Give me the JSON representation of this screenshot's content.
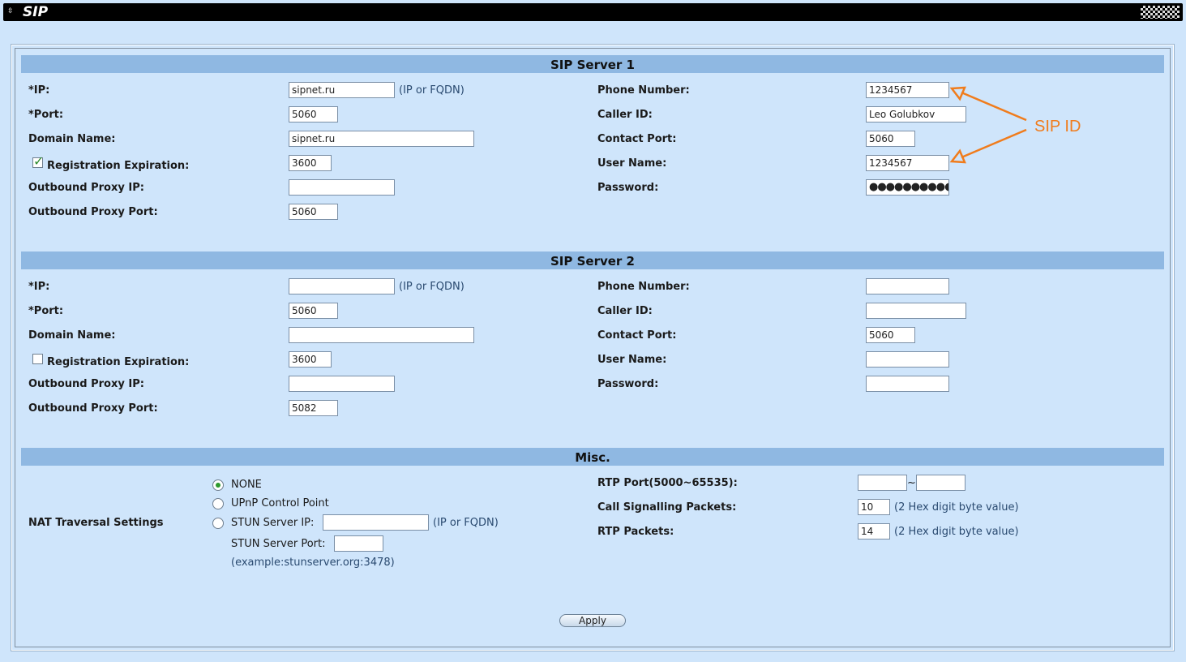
{
  "titlebar": {
    "title": "SIP",
    "icon": "menu-arrow-icon"
  },
  "server1": {
    "heading": "SIP Server 1",
    "ip_label": "*IP:",
    "ip_value": "sipnet.ru",
    "ip_hint": "(IP or FQDN)",
    "port_label": "*Port:",
    "port_value": "5060",
    "domain_label": "Domain Name:",
    "domain_value": "sipnet.ru",
    "reg_label": "Registration Expiration:",
    "reg_checked": true,
    "reg_value": "3600",
    "oproxy_ip_label": "Outbound Proxy IP:",
    "oproxy_ip_value": "",
    "oproxy_port_label": "Outbound Proxy Port:",
    "oproxy_port_value": "5060",
    "phone_label": "Phone Number:",
    "phone_value": "1234567",
    "callerid_label": "Caller ID:",
    "callerid_value": "Leo Golubkov",
    "contact_port_label": "Contact Port:",
    "contact_port_value": "5060",
    "username_label": "User Name:",
    "username_value": "1234567",
    "password_label": "Password:",
    "password_value": "●●●●●●●●●●●●●"
  },
  "server2": {
    "heading": "SIP Server 2",
    "ip_label": "*IP:",
    "ip_value": "",
    "ip_hint": "(IP or FQDN)",
    "port_label": "*Port:",
    "port_value": "5060",
    "domain_label": "Domain Name:",
    "domain_value": "",
    "reg_label": "Registration Expiration:",
    "reg_checked": false,
    "reg_value": "3600",
    "oproxy_ip_label": "Outbound Proxy IP:",
    "oproxy_ip_value": "",
    "oproxy_port_label": "Outbound Proxy Port:",
    "oproxy_port_value": "5082",
    "phone_label": "Phone Number:",
    "phone_value": "",
    "callerid_label": "Caller ID:",
    "callerid_value": "",
    "contact_port_label": "Contact Port:",
    "contact_port_value": "5060",
    "username_label": "User Name:",
    "username_value": "",
    "password_label": "Password:",
    "password_value": ""
  },
  "misc": {
    "heading": "Misc.",
    "nat_label": "NAT Traversal Settings",
    "opt_none": "NONE",
    "opt_upnp": "UPnP Control Point",
    "opt_stun_ip": "STUN Server IP:",
    "stun_ip_value": "",
    "stun_ip_hint": "(IP or FQDN)",
    "stun_port_label": "STUN Server Port:",
    "stun_port_value": "",
    "stun_example": "(example:stunserver.org:3478)",
    "selected_option": "NONE",
    "rtp_port_label": "RTP Port(5000~65535):",
    "rtp_port_from": "",
    "rtp_sep": "~",
    "rtp_port_to": "",
    "call_sig_label": "Call Signalling Packets:",
    "call_sig_value": "10",
    "call_sig_hint": "(2 Hex digit byte value)",
    "rtp_packets_label": "RTP Packets:",
    "rtp_packets_value": "14",
    "rtp_packets_hint": "(2 Hex digit byte value)"
  },
  "apply_label": "Apply",
  "annotation": {
    "label": "SIP ID",
    "color": "#f07c1c"
  },
  "colors": {
    "background": "#cfe5fb",
    "section_bar": "#8fb8e2",
    "titlebar": "#000000"
  }
}
